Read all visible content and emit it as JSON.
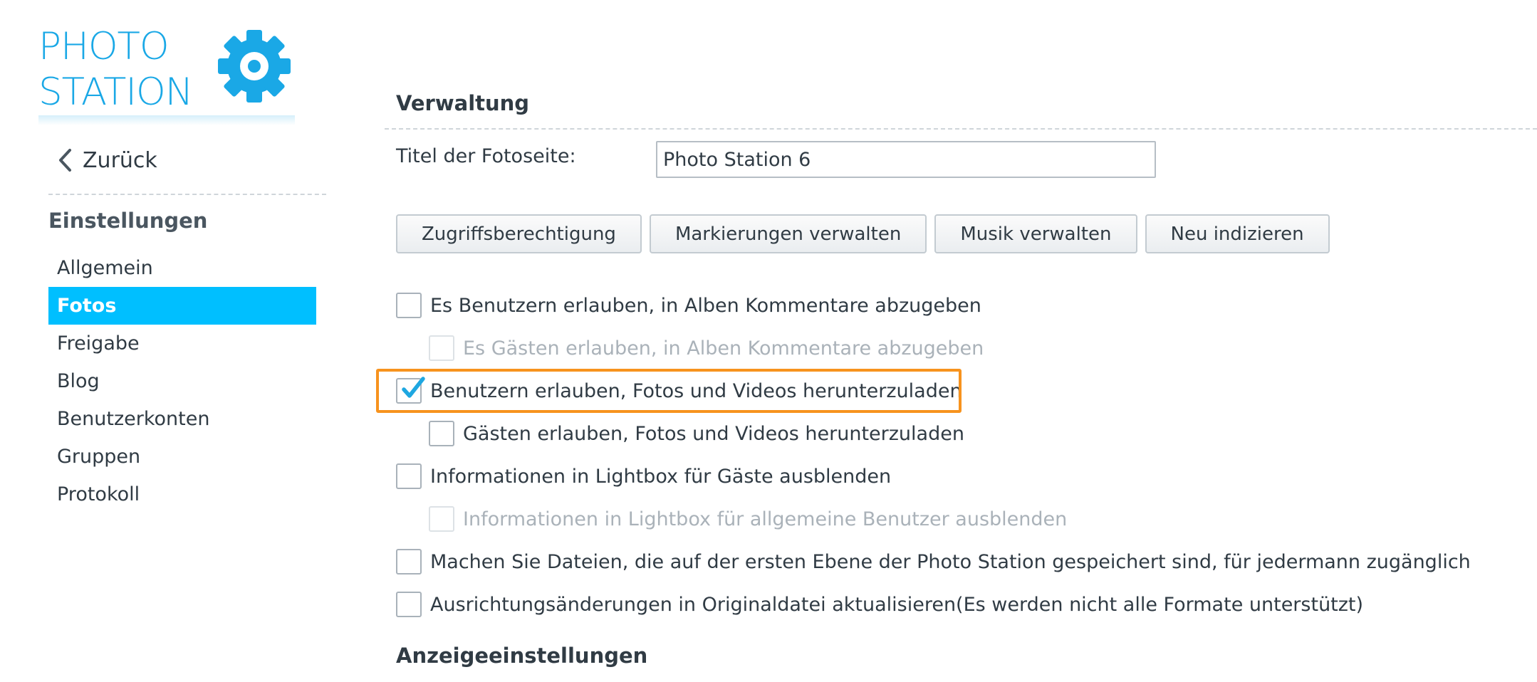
{
  "logo": {
    "line1": "PHOTO",
    "line2": "STATION",
    "brand_color": "#1aa8e6",
    "icon": "gear-icon"
  },
  "sidebar": {
    "back_label": "Zurück",
    "back_icon": "chevron-left-icon",
    "section_title": "Einstellungen",
    "active_color": "#00bfff",
    "items": [
      {
        "label": "Allgemein",
        "active": false
      },
      {
        "label": "Fotos",
        "active": true
      },
      {
        "label": "Freigabe",
        "active": false
      },
      {
        "label": "Blog",
        "active": false
      },
      {
        "label": "Benutzerkonten",
        "active": false
      },
      {
        "label": "Gruppen",
        "active": false
      },
      {
        "label": "Protokoll",
        "active": false
      }
    ]
  },
  "main": {
    "section_title": "Verwaltung",
    "photo_page_title_label": "Titel der Fotoseite:",
    "photo_page_title_value": "Photo Station 6",
    "buttons": [
      "Zugriffsberechtigung",
      "Markierungen verwalten",
      "Musik verwalten",
      "Neu indizieren"
    ],
    "options": [
      {
        "label": "Es Benutzern erlauben, in Alben Kommentare abzugeben",
        "checked": false,
        "disabled": false,
        "indent": false
      },
      {
        "label": "Es Gästen erlauben, in Alben Kommentare abzugeben",
        "checked": false,
        "disabled": true,
        "indent": true
      },
      {
        "label": "Benutzern erlauben, Fotos und Videos herunterzuladen",
        "checked": true,
        "disabled": false,
        "indent": false,
        "highlighted": true
      },
      {
        "label": "Gästen erlauben, Fotos und Videos herunterzuladen",
        "checked": false,
        "disabled": false,
        "indent": true
      },
      {
        "label": "Informationen in Lightbox für Gäste ausblenden",
        "checked": false,
        "disabled": false,
        "indent": false
      },
      {
        "label": "Informationen in Lightbox für allgemeine Benutzer ausblenden",
        "checked": false,
        "disabled": true,
        "indent": true
      },
      {
        "label": "Machen Sie Dateien, die auf der ersten Ebene der Photo Station gespeichert sind, für jedermann zugänglich",
        "checked": false,
        "disabled": false,
        "indent": false
      },
      {
        "label": "Ausrichtungsänderungen in Originaldatei aktualisieren(Es werden nicht alle Formate unterstützt)",
        "checked": false,
        "disabled": false,
        "indent": false
      }
    ],
    "display_section_title": "Anzeigeeinstellungen",
    "highlight_color": "#f7931e",
    "check_color": "#1ea7e1"
  }
}
